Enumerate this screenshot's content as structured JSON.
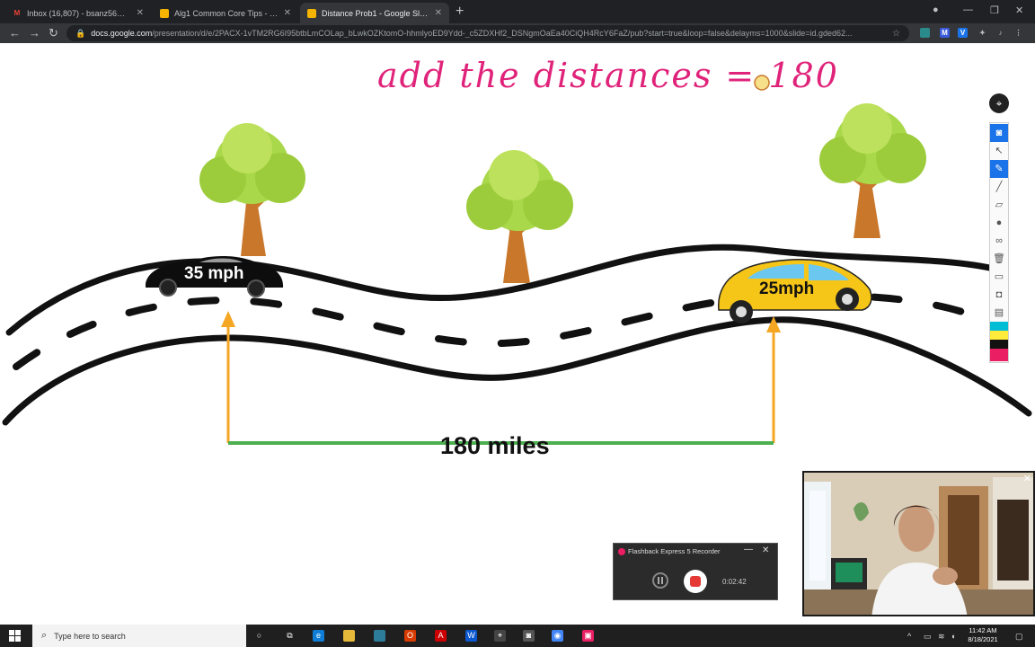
{
  "browser": {
    "tabs": [
      {
        "label": "Inbox (16,807) - bsanz56@gm...",
        "favicon": "gmail-icon",
        "active": false
      },
      {
        "label": "Alg1 Common Core Tips - One...",
        "favicon": "slides-icon",
        "active": false
      },
      {
        "label": "Distance Prob1 - Google Slides",
        "favicon": "slides-icon",
        "active": true
      }
    ],
    "url_host": "docs.google.com",
    "url_path": "/presentation/d/e/2PACX-1vTM2RG6I95btbLmCOLap_bLwkOZKtomO-hhmlyoED9Ydd-_c5ZDXHf2_DSNgmOaEa40CiQH4RcY6FaZ/pub?start=true&loop=false&delayms=1000&slide=id.gded62...",
    "accent": "#1a73e8"
  },
  "slide": {
    "handwriting": "add the distances = 180",
    "car_black_label": "35 mph",
    "car_yellow_label": "25mph",
    "distance_label": "180 miles",
    "colors": {
      "arrow": "#f5a623",
      "distance_line": "#4caf50",
      "handwriting": "#e0237a",
      "road": "#111111",
      "yellow_car": "#f5c518"
    }
  },
  "annotation_toolbar": {
    "tools": [
      "camera-icon",
      "cursor-icon",
      "pen-icon",
      "marker-icon",
      "eraser-icon",
      "dot-icon",
      "text-icon",
      "trash-icon",
      "whiteboard-icon",
      "capture-icon",
      "clipboard-icon"
    ],
    "swatches": [
      "#00bcd4",
      "#ffeb3b",
      "#111111",
      "#e91e63"
    ]
  },
  "recorder": {
    "title": "Flashback Express 5 Recorder",
    "elapsed": "0:02:42"
  },
  "taskbar": {
    "search_placeholder": "Type here to search",
    "time": "11:42 AM",
    "date": "8/18/2021"
  }
}
